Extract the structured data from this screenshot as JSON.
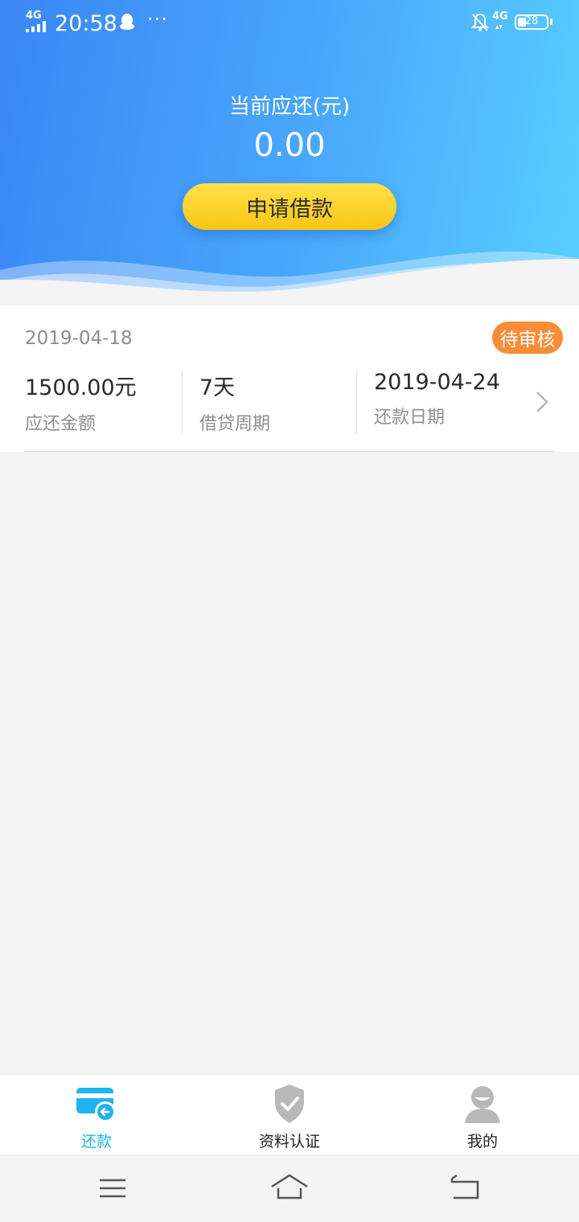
{
  "status_bar": {
    "network_left": "4G",
    "time": "20:58",
    "overflow": "···",
    "network_right": "4G",
    "battery": "28",
    "icons": [
      "signal-icon",
      "qq-penguin-icon",
      "bell-off-icon",
      "battery-icon"
    ]
  },
  "header": {
    "title": "当前应还(元)",
    "amount": "0.00",
    "apply_button": "申请借款"
  },
  "loan_card": {
    "date": "2019-04-18",
    "status_badge": "待审核",
    "columns": [
      {
        "value": "1500.00元",
        "label": "应还金额"
      },
      {
        "value": "7天",
        "label": "借贷周期"
      },
      {
        "value": "2019-04-24",
        "label": "还款日期"
      }
    ]
  },
  "tabbar": {
    "tabs": [
      {
        "label": "还款",
        "icon": "repay-card-icon",
        "active": true
      },
      {
        "label": "资料认证",
        "icon": "shield-check-icon",
        "active": false
      },
      {
        "label": "我的",
        "icon": "user-avatar-icon",
        "active": false
      }
    ]
  },
  "colors": {
    "gradient_start": "#3a86f5",
    "gradient_end": "#58cffe",
    "button_yellow": "#f9c514",
    "badge_orange": "#f98c37",
    "tab_active": "#1fb4ee"
  }
}
